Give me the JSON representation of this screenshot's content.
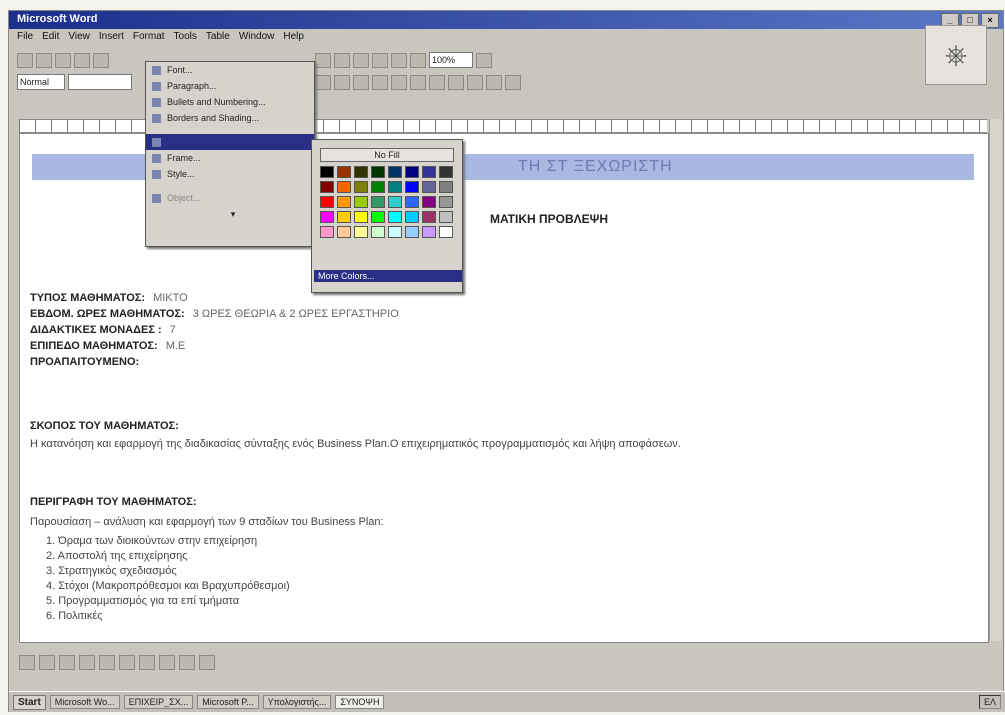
{
  "app": {
    "window_title": "Microsoft Word"
  },
  "menubar": [
    "File",
    "Edit",
    "View",
    "Insert",
    "Format",
    "Tools",
    "Table",
    "Window",
    "Help"
  ],
  "toolbar": {
    "style_value": "Normal",
    "zoom_value": "100%"
  },
  "format_menu": {
    "items": [
      {
        "label": "Font...",
        "state": "normal"
      },
      {
        "label": "Paragraph...",
        "state": "normal"
      },
      {
        "label": "Bullets and Numbering...",
        "state": "normal"
      },
      {
        "label": "Borders and Shading...",
        "state": "normal"
      },
      {
        "label": "",
        "state": "selected"
      },
      {
        "label": "Frame...",
        "state": "normal"
      },
      {
        "label": "Style...",
        "state": "normal"
      },
      {
        "label": "Object...",
        "state": "disabled"
      }
    ]
  },
  "palette": {
    "no_fill_label": "No Fill",
    "more_colors_label": "More Colors...",
    "colors": [
      "#000000",
      "#993300",
      "#333300",
      "#003300",
      "#003366",
      "#000080",
      "#333399",
      "#333333",
      "#800000",
      "#ff6600",
      "#808000",
      "#008000",
      "#008080",
      "#0000ff",
      "#666699",
      "#808080",
      "#ff0000",
      "#ff9900",
      "#99cc00",
      "#339966",
      "#33cccc",
      "#3366ff",
      "#800080",
      "#969696",
      "#ff00ff",
      "#ffcc00",
      "#ffff00",
      "#00ff00",
      "#00ffff",
      "#00ccff",
      "#993366",
      "#c0c0c0",
      "#ff99cc",
      "#ffcc99",
      "#ffff99",
      "#ccffcc",
      "#ccffff",
      "#99ccff",
      "#cc99ff",
      "#ffffff"
    ]
  },
  "document": {
    "banner_text": "ΤΗ ΣΤ ΞΕΧΩΡΙΣΤΗ",
    "heading": "ΜΑΤΙΚΗ ΠΡΟΒΛΕΨΗ",
    "fields": [
      {
        "label": "ΤΥΠΟΣ ΜΑΘΗΜΑΤΟΣ:",
        "value": "ΜΙΚΤΟ"
      },
      {
        "label": "ΕΒΔΟΜ. ΩΡΕΣ ΜΑΘΗΜΑΤΟΣ:",
        "value": "3 ΩΡΕΣ ΘΕΩΡΙΑ & 2 ΩΡΕΣ ΕΡΓΑΣΤΗΡΙΟ"
      },
      {
        "label": "ΔΙΔΑΚΤΙΚΕΣ ΜΟΝΑΔΕΣ :",
        "value": "7"
      },
      {
        "label": "ΕΠΙΠΕΔΟ ΜΑΘΗΜΑΤΟΣ:",
        "value": "Μ.Ε"
      },
      {
        "label": "ΠΡΟΑΠΑΙΤΟΥΜΕΝΟ:",
        "value": ""
      }
    ],
    "purpose_title": "ΣΚΟΠΟΣ ΤΟΥ ΜΑΘΗΜΑΤΟΣ:",
    "purpose_text": "Η κατανόηση και εφαρμογή της διαδικασίας σύνταξης ενός Business Plan.Ο επιχειρηματικός προγραμματισμός και λήψη αποφάσεων.",
    "description_title": "ΠΕΡΙΓΡΑΦΗ ΤΟΥ ΜΑΘΗΜΑΤΟΣ:",
    "description_intro": "Παρουσίαση – ανάλυση και εφαρμογή των 9 σταδίων του Business Plan:",
    "list": [
      "1. Όραμα των διοικούντων στην επιχείρηση",
      "2. Αποστολή της επιχείρησης",
      "3. Στρατηγικός σχεδιασμός",
      "4. Στόχοι (Μακροπρόθεσμοι και Βραχυπρόθεσμοι)",
      "5. Προγραμματισμός για τα επί τμήματα",
      "6. Πολιτικές"
    ]
  },
  "taskbar": {
    "start_label": "Start",
    "tasks": [
      "Microsoft Wo...",
      "ΕΠΙΧΕΙΡ_ΣΧ...",
      "Microsoft P...",
      "Υπολογιστής...",
      "ΣΥΝΟΨΗ"
    ],
    "active_index": 4,
    "tray_text": "ΕΛ"
  }
}
